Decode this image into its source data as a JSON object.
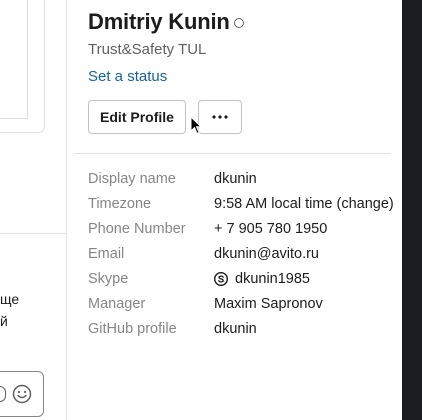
{
  "left_pane": {
    "text_line_1": "ще",
    "text_line_2": "й"
  },
  "profile": {
    "name": "Dmitriy Kunin",
    "title": "Trust&Safety TUL",
    "set_status_label": "Set a status",
    "edit_profile_label": "Edit Profile",
    "more_label": "•••",
    "presence": "away"
  },
  "fields": [
    {
      "label": "Display name",
      "value": "dkunin"
    },
    {
      "label": "Timezone",
      "value": "9:58 AM local time (change)"
    },
    {
      "label": "Phone Number",
      "value": "+ 7 905 780 1950"
    },
    {
      "label": "Email",
      "value": "dkunin@avito.ru"
    },
    {
      "label": "Skype",
      "value": "dkunin1985",
      "icon": "skype-icon"
    },
    {
      "label": "Manager",
      "value": "Maxim Sapronov"
    },
    {
      "label": "GitHub profile",
      "value": "dkunin"
    }
  ],
  "colors": {
    "link": "#1264a3",
    "muted": "#868686",
    "text": "#1d1c1d",
    "dark_strip": "#1a1d21"
  }
}
